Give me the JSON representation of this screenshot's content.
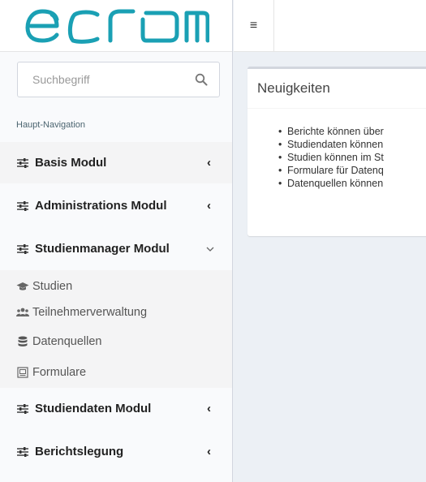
{
  "brand": {
    "logo_text": "ecrom"
  },
  "search": {
    "placeholder": "Suchbegriff"
  },
  "sidebar": {
    "nav_header": "Haupt-Navigation",
    "items": [
      {
        "label": "Basis Modul",
        "chevron": "‹",
        "active": true
      },
      {
        "label": "Administrations Modul",
        "chevron": "‹"
      },
      {
        "label": "Studienmanager Modul",
        "chevron": "⌄",
        "expanded": true
      },
      {
        "label": "Studiendaten Modul",
        "chevron": "‹"
      },
      {
        "label": "Berichtslegung",
        "chevron": "‹"
      }
    ],
    "submenu": [
      {
        "label": "Studien",
        "icon": "graduation-cap-icon"
      },
      {
        "label": "Teilnehmerverwaltung",
        "icon": "users-icon"
      },
      {
        "label": "Datenquellen",
        "icon": "database-icon"
      },
      {
        "label": "Formulare",
        "icon": "form-icon"
      }
    ]
  },
  "topbar": {
    "toggle_icon": "≡"
  },
  "news": {
    "title": "Neuigkeiten",
    "items": [
      "Berichte können über",
      "Studiendaten können",
      "Studien können im St",
      "Formulare für Datenq",
      "Datenquellen können"
    ]
  },
  "colors": {
    "logo": "#1aa0b4",
    "sidebar_bg": "#f9fafc",
    "body_bg": "#ecf0f5"
  }
}
